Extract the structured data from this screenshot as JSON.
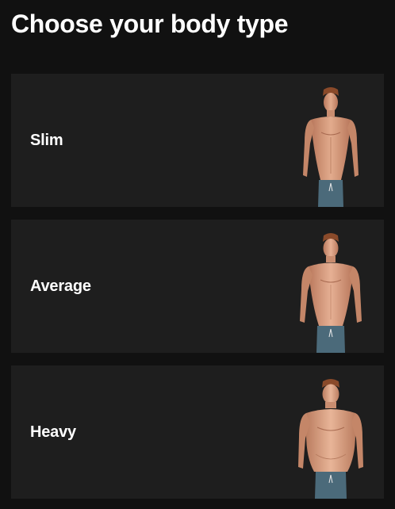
{
  "page": {
    "title": "Choose your body type"
  },
  "options": [
    {
      "label": "Slim",
      "image": "slim-body-figure"
    },
    {
      "label": "Average",
      "image": "average-body-figure"
    },
    {
      "label": "Heavy",
      "image": "heavy-body-figure"
    }
  ],
  "colors": {
    "background": "#111111",
    "card": "#1e1e1e",
    "text": "#ffffff",
    "skin": "#d9a184",
    "hair": "#8a4a2a",
    "shorts": "#4b6a7a"
  }
}
